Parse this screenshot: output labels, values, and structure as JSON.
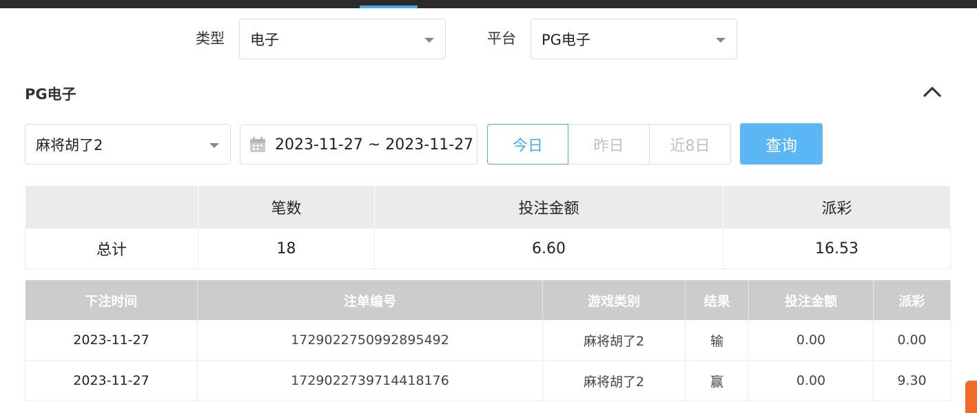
{
  "filters": {
    "type_label": "类型",
    "type_value": "电子",
    "platform_label": "平台",
    "platform_value": "PG电子"
  },
  "section": {
    "title": "PG电子"
  },
  "query_bar": {
    "game_value": "麻将胡了2",
    "date_range": "2023-11-27 ~ 2023-11-27",
    "quick_today": "今日",
    "quick_yesterday": "昨日",
    "quick_8days": "近8日",
    "search_label": "查询"
  },
  "summary": {
    "headers": [
      "",
      "笔数",
      "投注金额",
      "派彩"
    ],
    "row": [
      "总计",
      "18",
      "6.60",
      "16.53"
    ]
  },
  "detail": {
    "headers": [
      "下注时间",
      "注单编号",
      "游戏类别",
      "结果",
      "投注金额",
      "派彩"
    ],
    "rows": [
      [
        "2023-11-27",
        "1729022750992895492",
        "麻将胡了2",
        "输",
        "0.00",
        "0.00"
      ],
      [
        "2023-11-27",
        "1729022739714418176",
        "麻将胡了2",
        "赢",
        "0.00",
        "9.30"
      ]
    ]
  },
  "colors": {
    "accent": "#4aa8ec",
    "button": "#5bb8f5",
    "header_bg": "#cccccc",
    "summary_header_bg": "#ebebeb"
  }
}
